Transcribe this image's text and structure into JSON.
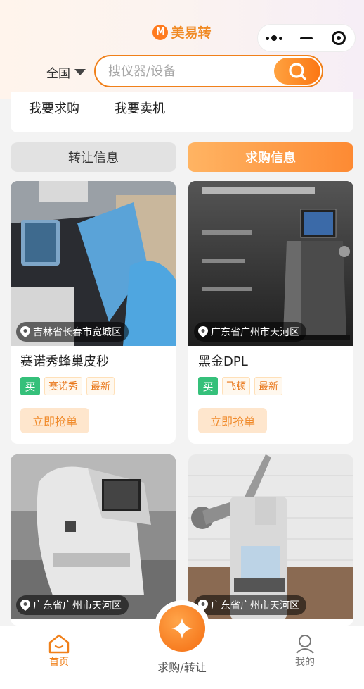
{
  "app": {
    "title": "美易转",
    "logo_letter": "M"
  },
  "capsule": {
    "more": "more-dots-icon",
    "minimize": "minimize-icon",
    "close": "target-close-icon"
  },
  "search": {
    "region": "全国",
    "placeholder": "搜仪器/设备",
    "value": ""
  },
  "menu": {
    "buy_request": "我要求购",
    "sell_machine": "我要卖机"
  },
  "tabs": {
    "transfer": "转让信息",
    "buy": "求购信息",
    "active": "buy"
  },
  "cards": [
    {
      "location": "吉林省长春市宽城区",
      "title": "赛诺秀蜂巢皮秒",
      "tags": [
        "买",
        "赛诺秀",
        "最新"
      ],
      "action": "立即抢单"
    },
    {
      "location": "广东省广州市天河区",
      "title": "黑金DPL",
      "tags": [
        "买",
        "飞顿",
        "最新"
      ],
      "action": "立即抢单"
    },
    {
      "location": "广东省广州市天河区",
      "title": "",
      "tags": [],
      "action": ""
    },
    {
      "location": "广东省广州市天河区",
      "title": "",
      "tags": [],
      "action": ""
    }
  ],
  "tabbar": {
    "home": "首页",
    "center": "求购/转让",
    "me": "我的"
  },
  "colors": {
    "accent": "#f0801a",
    "buy_tag": "#35c07a",
    "tag_text": "#e9781c"
  }
}
